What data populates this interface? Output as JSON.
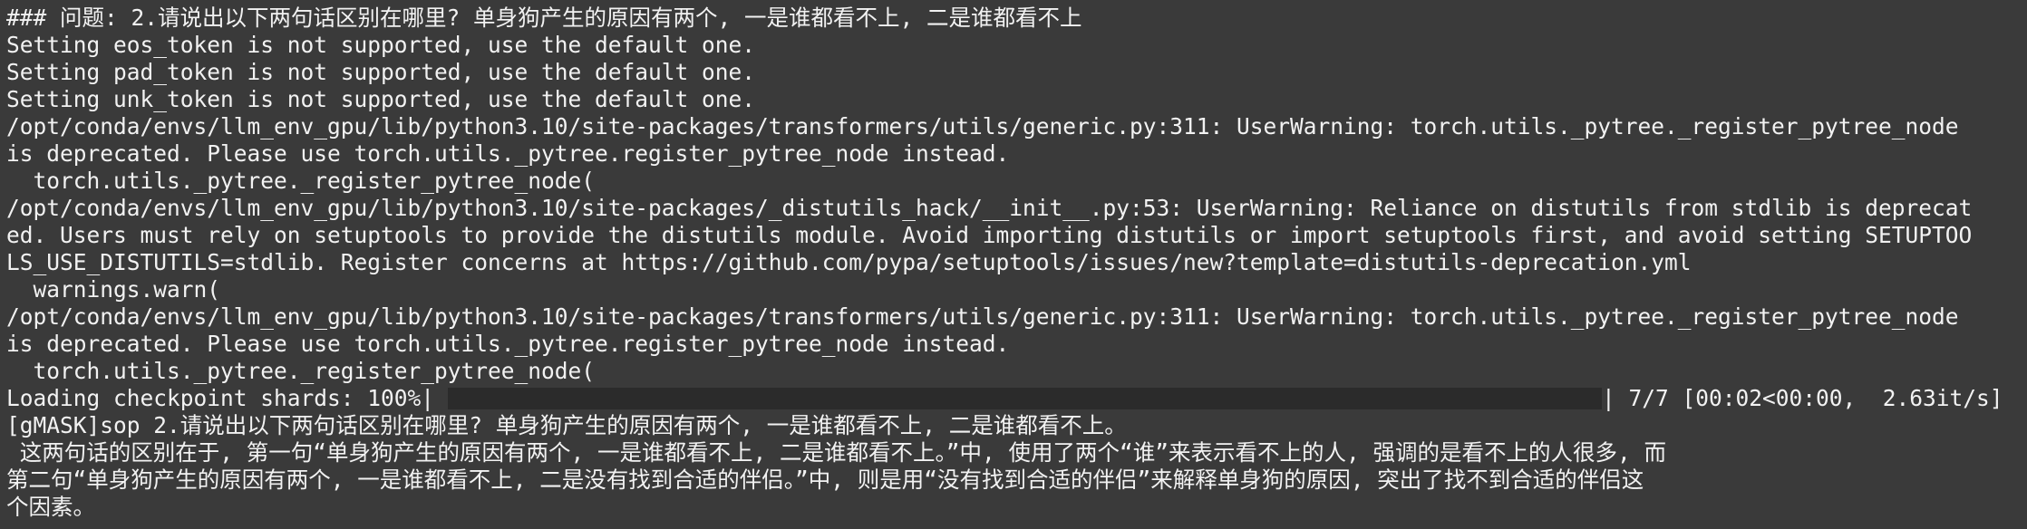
{
  "terminal": {
    "lines": [
      "### 问题: 2.请说出以下两句话区别在哪里? 单身狗产生的原因有两个, 一是谁都看不上, 二是谁都看不上",
      "Setting eos_token is not supported, use the default one.",
      "Setting pad_token is not supported, use the default one.",
      "Setting unk_token is not supported, use the default one.",
      "/opt/conda/envs/llm_env_gpu/lib/python3.10/site-packages/transformers/utils/generic.py:311: UserWarning: torch.utils._pytree._register_pytree_node",
      "is deprecated. Please use torch.utils._pytree.register_pytree_node instead.",
      "  torch.utils._pytree._register_pytree_node(",
      "/opt/conda/envs/llm_env_gpu/lib/python3.10/site-packages/_distutils_hack/__init__.py:53: UserWarning: Reliance on distutils from stdlib is deprecat",
      "ed. Users must rely on setuptools to provide the distutils module. Avoid importing distutils or import setuptools first, and avoid setting SETUPTOO",
      "LS_USE_DISTUTILS=stdlib. Register concerns at https://github.com/pypa/setuptools/issues/new?template=distutils-deprecation.yml",
      "  warnings.warn(",
      "/opt/conda/envs/llm_env_gpu/lib/python3.10/site-packages/transformers/utils/generic.py:311: UserWarning: torch.utils._pytree._register_pytree_node",
      "is deprecated. Please use torch.utils._pytree.register_pytree_node instead.",
      "  torch.utils._pytree._register_pytree_node("
    ],
    "progress": {
      "prefix": "Loading checkpoint shards: 100%|",
      "suffix": "| 7/7 [00:02<00:00,  2.63it/s]",
      "percent": 100
    },
    "output_lines": [
      "[gMASK]sop 2.请说出以下两句话区别在哪里? 单身狗产生的原因有两个, 一是谁都看不上, 二是谁都看不上。",
      " 这两句话的区别在于, 第一句“单身狗产生的原因有两个, 一是谁都看不上, 二是谁都看不上。”中, 使用了两个“谁”来表示看不上的人, 强调的是看不上的人很多, 而",
      "第二句“单身狗产生的原因有两个, 一是谁都看不上, 二是没有找到合适的伴侣。”中, 则是用“没有找到合适的伴侣”来解释单身狗的原因, 突出了找不到合适的伴侣这",
      "个因素。"
    ]
  }
}
